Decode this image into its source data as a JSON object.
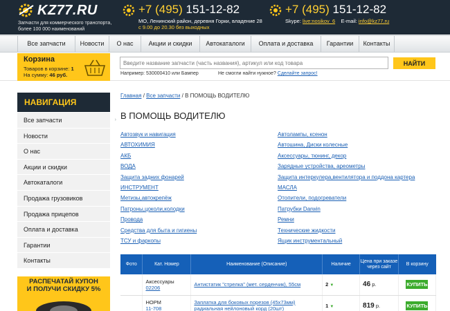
{
  "header": {
    "logo_text": "KZ77.RU",
    "tagline": "Запчасти для коммерческого транспорта, более 100 000 наименований",
    "phone1_prefix": "+7 (495)",
    "phone1_number": "151-12-82",
    "address": "МО, Ленинский район, деревня Горки, владение 28",
    "hours": "с 9.00 до 20.30 без выходных",
    "phone2_prefix": "+7 (495)",
    "phone2_number": "151-12-82",
    "skype_label": "Skype:",
    "skype_value": "live:nosikov_6",
    "email_label": "E-mail:",
    "email_value": "info@kz77.ru",
    "accent_color": "#ffc61a",
    "icon": "gear-icon"
  },
  "nav": {
    "items": [
      "Все запчасти",
      "Новости",
      "О нас",
      "Акции и скидки",
      "Автокаталоги",
      "Оплата и доставка",
      "Гарантии",
      "Контакты"
    ]
  },
  "cart": {
    "title": "Корзина",
    "items_label": "Товаров в корзине:",
    "items_count": "1",
    "sum_label": "На сумму:",
    "sum_value": "46 руб.",
    "icon": "basket-icon"
  },
  "search": {
    "placeholder": "Введите название запчасти (часть названия), артикул или код товара",
    "button": "НАЙТИ",
    "example": "Например: 530000410 или Бампер",
    "notfound": "Не смогли найти нужное?",
    "request_link": "Сделайте запрос!"
  },
  "sidebar": {
    "heading": "НАВИГАЦИЯ",
    "items": [
      "Все запчасти",
      "Новости",
      "О нас",
      "Акции и скидки",
      "Автокаталоги",
      "Продажа грузовиков",
      "Продажа прицепов",
      "Оплата и доставка",
      "Гарантии",
      "Контакты"
    ],
    "promo_line1": "РАСПЕЧАТАЙ КУПОН",
    "promo_line2": "И ПОЛУЧИ СКИДКУ 5%"
  },
  "breadcrumbs": {
    "home": "Главная",
    "sep": "/",
    "all": "Все запчасти",
    "current": "В ПОМОЩЬ ВОДИТЕЛЮ"
  },
  "page": {
    "title": "В ПОМОЩЬ ВОДИТЕЛЮ"
  },
  "categories_left": [
    "Автозвук и навигация",
    "АВТОХИМИЯ",
    "АКБ",
    "ВОДА",
    "Защита задних фонарей",
    "ИНСТРУМЕНТ",
    "Метизы,автокрепёж",
    "Патроны,цоколи,колодки",
    "Провода",
    "Средства для быта и гигиены",
    "ТСУ и фаркопы"
  ],
  "categories_right": [
    "Автолампы, ксенон",
    "Автошина, Диски колесные",
    "Аксессуары, тюнинг, декор",
    "Зарядные устройства, ареометры",
    "Защита интеркулера,вентилятора и поддона картера",
    "МАСЛА",
    "Отопители, подогреватели",
    "Патрубки Darwin",
    "Ремни",
    "Технические жидкости",
    "Ящик инструментальный"
  ],
  "table": {
    "headers": [
      "Фото",
      "Кат. Номер",
      "Наименование (Описание)",
      "Наличие",
      "Цена при заказе через сайт",
      "В корзину"
    ],
    "rows": [
      {
        "photo": "",
        "brand": "Аксессуары",
        "code": "02206",
        "name": "Антистатик \"стрелка\" (мет. серденчик), 55см",
        "qty": "2",
        "price": "46",
        "currency": "р.",
        "buy": "КУПИТЬ"
      },
      {
        "photo": "",
        "brand": "НОРМ",
        "code": "11-708",
        "name": "Заплатка для боковых порезов (45х73мм) радиальная нейлоновый корд (20шт)",
        "qty": "1",
        "price": "819",
        "currency": "р.",
        "buy": "КУПИТЬ"
      }
    ],
    "header_color": "#1560b8",
    "buy_color": "#3bab2c"
  }
}
